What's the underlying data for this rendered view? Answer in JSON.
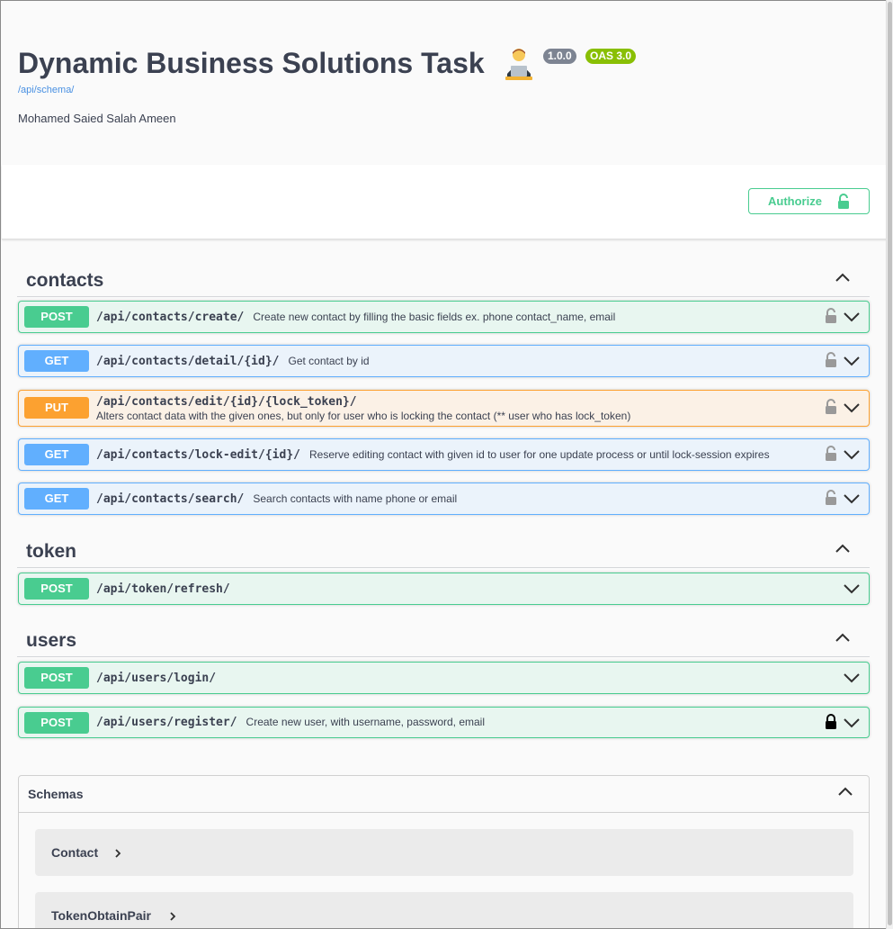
{
  "info": {
    "title": "Dynamic Business Solutions Task",
    "emoji_icon": "technologist-emoji-icon",
    "version_badge": "1.0.0",
    "oas_badge": "OAS 3.0",
    "schema_link": "/api/schema/",
    "author": "Mohamed Saied Salah Ameen"
  },
  "authorize": {
    "label": "Authorize",
    "icon": "unlock-icon"
  },
  "colors": {
    "post": "#49cc90",
    "get": "#61affe",
    "put": "#fca130",
    "text": "#3b4151",
    "link": "#4990e2"
  },
  "tags": [
    {
      "name": "contacts",
      "operations": [
        {
          "method": "POST",
          "path": "/api/contacts/create/",
          "summary": "Create new contact by filling the basic fields ex. phone contact_name, email",
          "locked": "open"
        },
        {
          "method": "GET",
          "path": "/api/contacts/detail/{id}/",
          "summary": "Get contact by id",
          "locked": "open"
        },
        {
          "method": "PUT",
          "path": "/api/contacts/edit/{id}/{lock_token}/",
          "summary": "Alters contact data with the given ones, but only for user who is locking the contact (** user who has lock_token)",
          "locked": "open"
        },
        {
          "method": "GET",
          "path": "/api/contacts/lock-edit/{id}/",
          "summary": "Reserve editing contact with given id to user for one update process or until lock-session expires",
          "locked": "open"
        },
        {
          "method": "GET",
          "path": "/api/contacts/search/",
          "summary": "Search contacts with name phone or email",
          "locked": "open"
        }
      ]
    },
    {
      "name": "token",
      "operations": [
        {
          "method": "POST",
          "path": "/api/token/refresh/",
          "summary": "",
          "locked": "none"
        }
      ]
    },
    {
      "name": "users",
      "operations": [
        {
          "method": "POST",
          "path": "/api/users/login/",
          "summary": "",
          "locked": "none"
        },
        {
          "method": "POST",
          "path": "/api/users/register/",
          "summary": "Create new user, with username, password, email",
          "locked": "closed"
        }
      ]
    }
  ],
  "schemas": {
    "label": "Schemas",
    "models": [
      "Contact",
      "TokenObtainPair"
    ]
  }
}
